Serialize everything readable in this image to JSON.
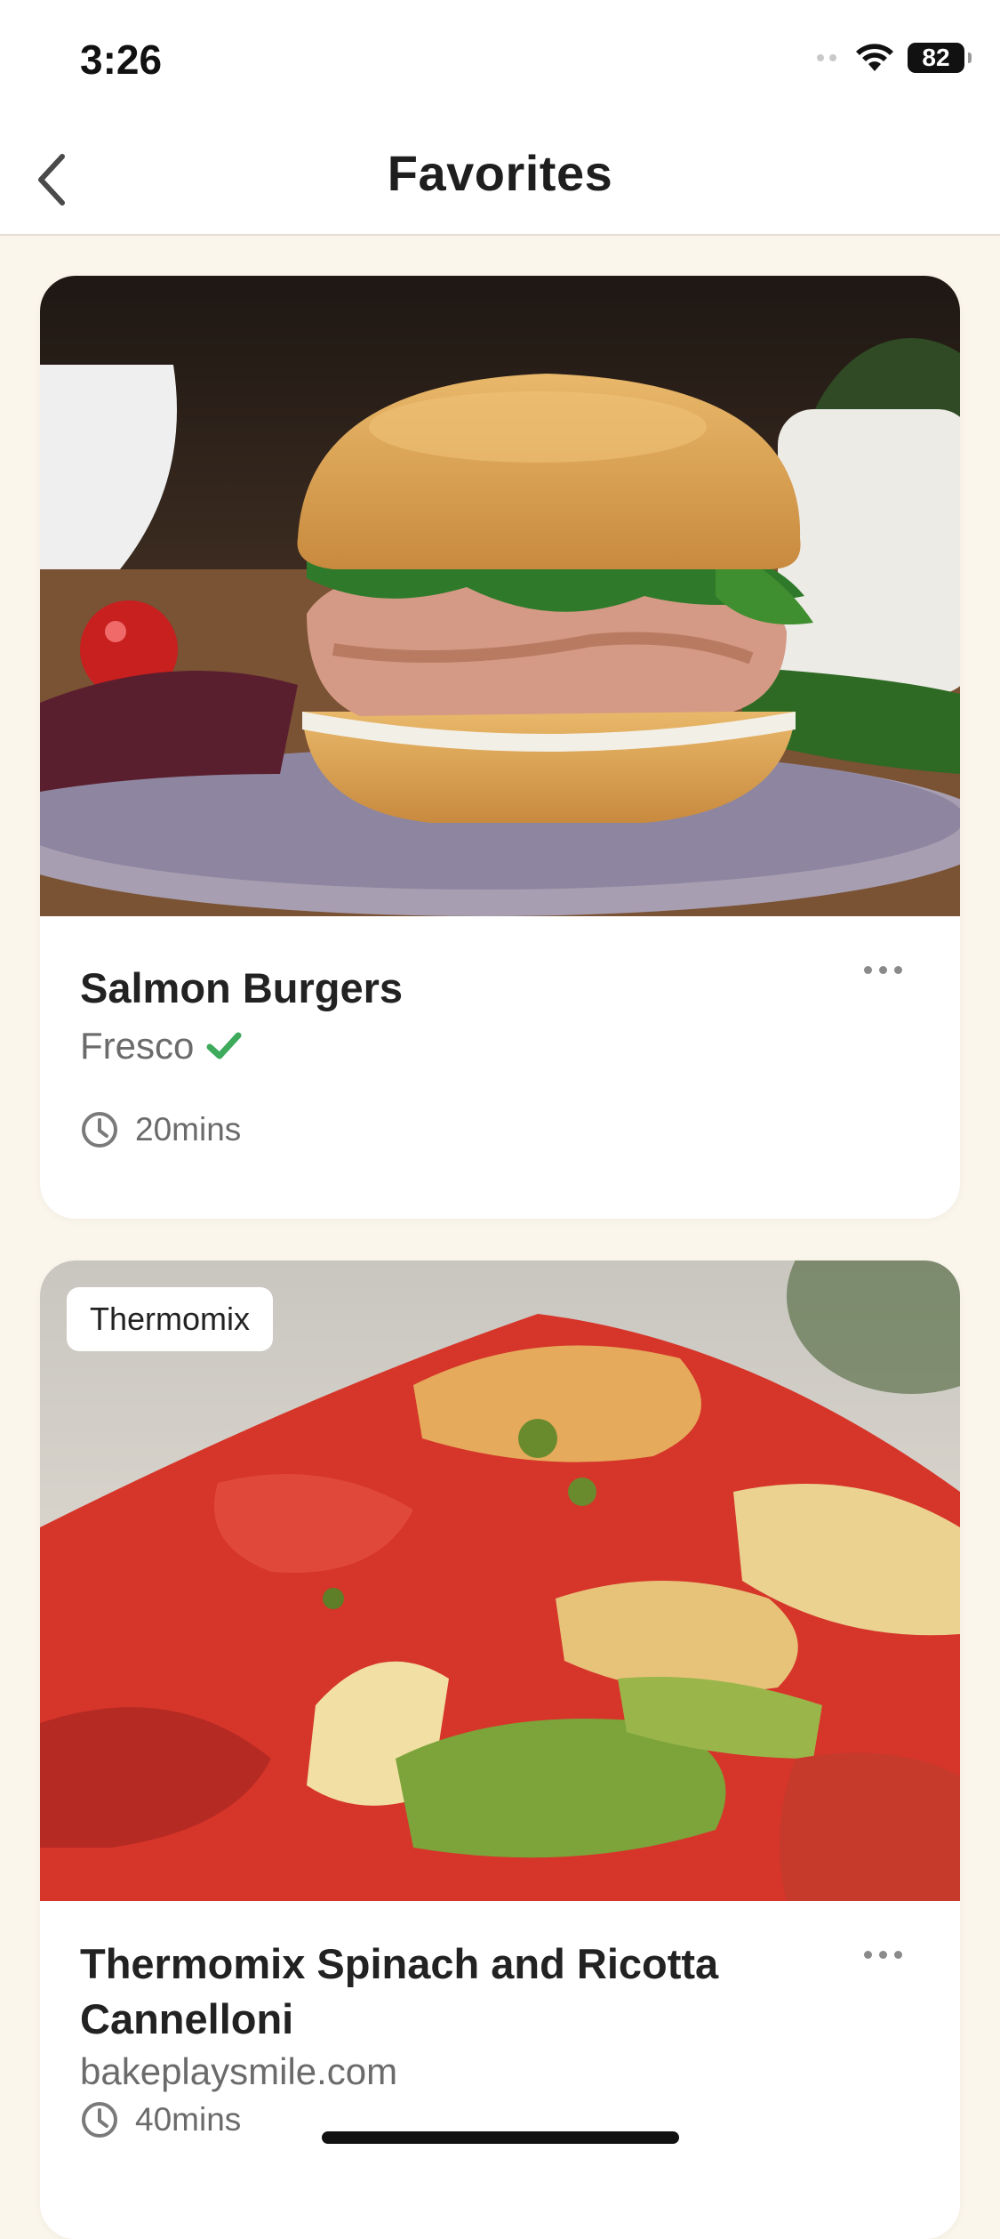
{
  "status_bar": {
    "time": "3:26",
    "battery": "82"
  },
  "header": {
    "title": "Favorites"
  },
  "recipes": [
    {
      "title": "Salmon Burgers",
      "source": "Fresco",
      "verified": true,
      "time": "20mins",
      "tag": ""
    },
    {
      "title": "Thermomix Spinach and Ricotta Cannelloni",
      "source": "bakeplaysmile.com",
      "verified": false,
      "time": "40mins",
      "tag": "Thermomix"
    }
  ],
  "colors": {
    "background": "#FBF6EC",
    "verified_check": "#3DAA5C",
    "text_primary": "#222222",
    "text_secondary": "#6B6B6B"
  },
  "icons": [
    "back-chevron-icon",
    "wifi-icon",
    "battery-icon",
    "more-dots-icon",
    "clock-icon",
    "check-icon"
  ]
}
